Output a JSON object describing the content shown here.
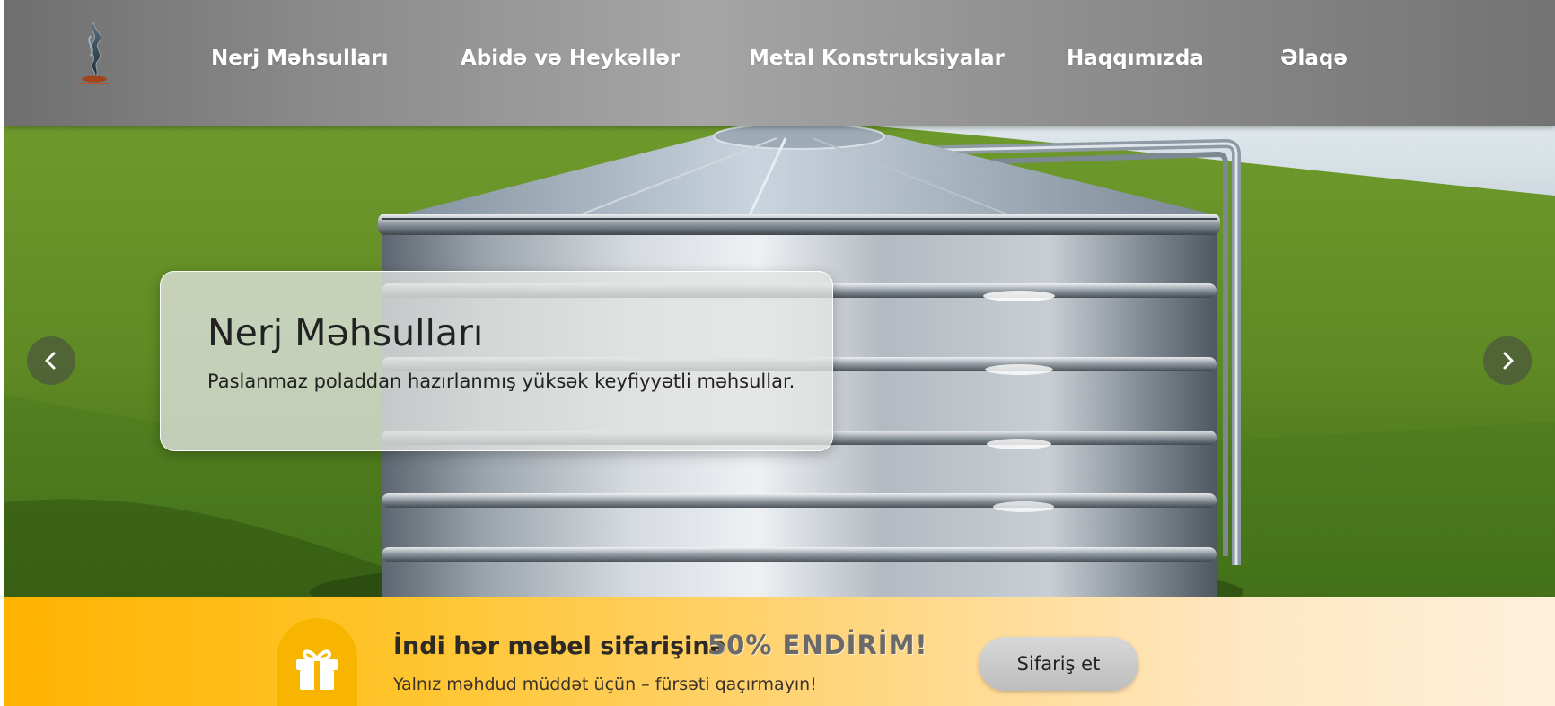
{
  "header": {
    "logo": "flame-sculpture-logo",
    "nav": [
      {
        "label": "Nerj Məhsulları"
      },
      {
        "label": "Abidə və Heykəllər"
      },
      {
        "label": "Metal Konstruksiyalar"
      },
      {
        "label": "Haqqımızda"
      },
      {
        "label": "Əlaqə"
      }
    ]
  },
  "hero": {
    "slide_image": "stainless-steel-water-tank-on-grass",
    "title": "Nerj Məhsulları",
    "text": "Paslanmaz poladdan hazırlanmış yüksək keyfiyyətli məhsullar.",
    "prev_icon": "chevron-left-icon",
    "next_icon": "chevron-right-icon"
  },
  "promo": {
    "icon": "gift-icon",
    "title": "İndi hər mebel sifarişinə",
    "discount": "50% ENDİRİM!",
    "subtitle": "Yalnız məhdud müddət üçün – fürsəti qaçırmayın!",
    "button_label": "Sifariş et"
  },
  "colors": {
    "promo_start": "#ffb300",
    "promo_end": "#fff0dc",
    "nav_text": "#ffffff"
  }
}
